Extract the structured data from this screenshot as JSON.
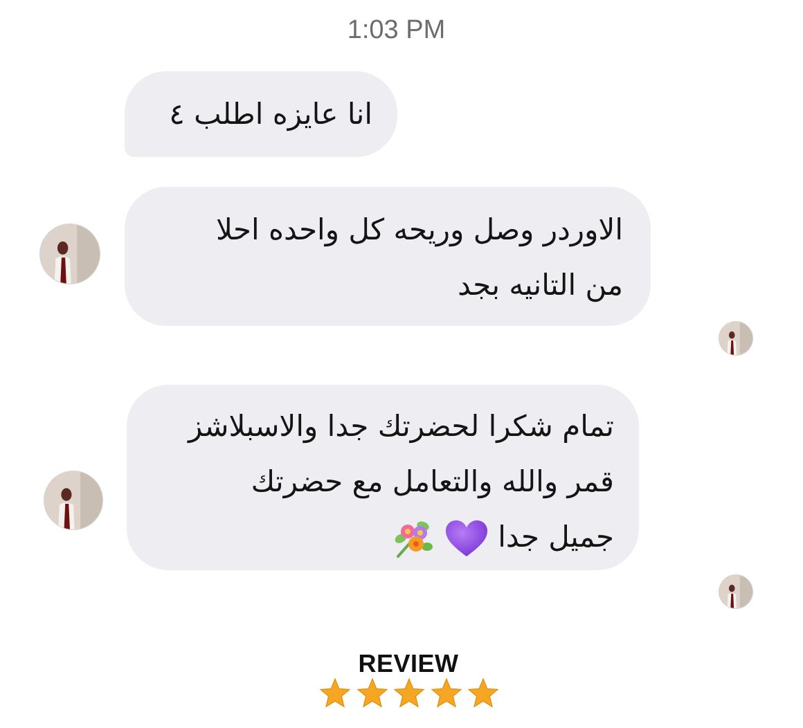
{
  "timestamp": "1:03 PM",
  "messages": [
    {
      "lines": [
        "انا عايزه اطلب ٤"
      ]
    },
    {
      "lines": [
        "الاوردر وصل وريحه كل واحده احلا",
        "من التانيه بجد"
      ]
    },
    {
      "lines": [
        "تمام شكرا لحضرتك جدا والاسبلاشز",
        "قمر والله والتعامل مع حضرتك",
        "جميل جدا"
      ],
      "emojis": [
        "purple-heart",
        "bouquet"
      ]
    }
  ],
  "review": {
    "label": "REVIEW",
    "stars": 5,
    "star_color": "#f5a623"
  },
  "colors": {
    "bubble": "#eeeef2",
    "timestamp": "#6b6b70",
    "text": "#141414"
  }
}
